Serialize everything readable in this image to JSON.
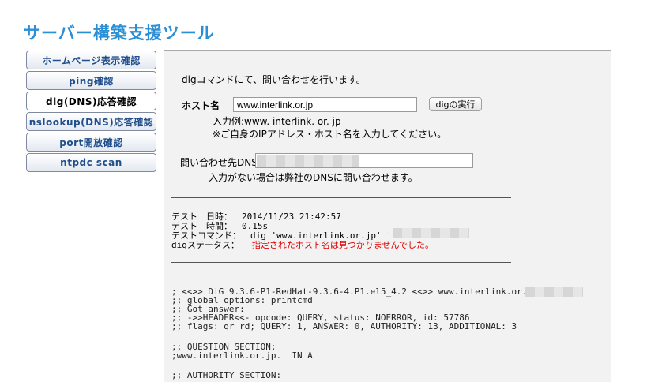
{
  "app": {
    "title": "サーバー構築支援ツール"
  },
  "nav": {
    "items": [
      {
        "label": "ホームページ表示確認"
      },
      {
        "label": "ping確認"
      },
      {
        "label": "dig(DNS)応答確認"
      },
      {
        "label": "nslookup(DNS)応答確認"
      },
      {
        "label": "port開放確認"
      },
      {
        "label": "ntpdc scan"
      }
    ]
  },
  "form": {
    "intro": "digコマンドにて、問い合わせを行います。",
    "host_label": "ホスト名",
    "host_value": "www.interlink.or.jp",
    "run_button": "digの実行",
    "example": "入力例:www. interlink. or. jp",
    "example_note": "※ご自身のIPアドレス・ホスト名を入力してください。",
    "dns_label": "問い合わせ先DNS=",
    "dns_value": "",
    "dns_note": "入力がない場合は弊社のDNSに問い合わせます。"
  },
  "result": {
    "datetime_label": "テスト　日時：",
    "datetime_value": "2014/11/23 21:42:57",
    "time_label": "テスト　時間：",
    "time_value": "0.15s",
    "command_label": "テストコマンド：",
    "command_value": "dig 'www.interlink.or.jp' '",
    "status_label": "digステータス：",
    "status_value": "指定されたホスト名は見つかりませんでした。"
  },
  "dig_output": {
    "line1": "; <<>> DiG 9.3.6-P1-RedHat-9.3.6-4.P1.el5_4.2 <<>> www.interlink.or.jp @",
    "line2": ";; global options: printcmd",
    "line3": ";; Got answer:",
    "line4": ";; ->>HEADER<<- opcode: QUERY, status: NOERROR, id: 57786",
    "line5": ";; flags: qr rd; QUERY: 1, ANSWER: 0, AUTHORITY: 13, ADDITIONAL: 3",
    "line6": ";; QUESTION SECTION:",
    "line7": ";www.interlink.or.jp.  IN A",
    "line8": ";; AUTHORITY SECTION:"
  },
  "colors": {
    "title": "#2b8fd6",
    "nav_text": "#1f4e8c",
    "error": "#e00000"
  }
}
